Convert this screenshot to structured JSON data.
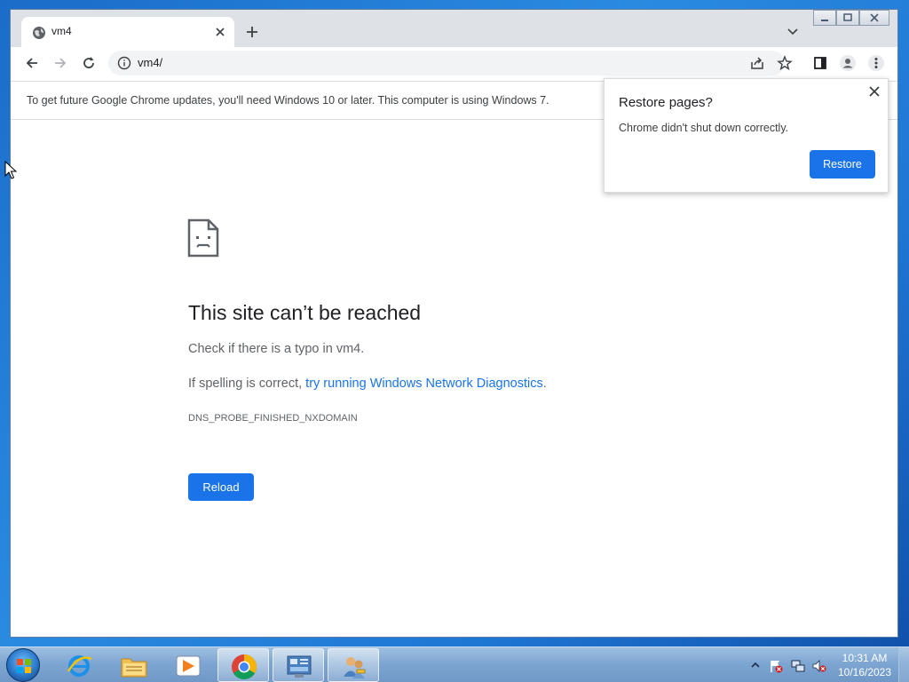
{
  "browser": {
    "tab_title": "vm4",
    "url": "vm4/",
    "infobar_text": "To get future Google Chrome updates, you'll need Windows 10 or later. This computer is using Windows 7."
  },
  "error_page": {
    "title": "This site can’t be reached",
    "line1": "Check if there is a typo in vm4.",
    "line2_prefix": "If spelling is correct, ",
    "line2_link": "try running Windows Network Diagnostics",
    "line2_suffix": ".",
    "error_code": "DNS_PROBE_FINISHED_NXDOMAIN",
    "reload_label": "Reload"
  },
  "restore_popup": {
    "title": "Restore pages?",
    "text": "Chrome didn't shut down correctly.",
    "button_label": "Restore"
  },
  "taskbar": {
    "items": [
      "internet-explorer",
      "windows-explorer",
      "media-player",
      "google-chrome",
      "control-panel",
      "user-accounts"
    ],
    "active_item": "google-chrome",
    "clock_time": "10:31 AM",
    "clock_date": "10/16/2023"
  },
  "colors": {
    "accent": "#1a73e8",
    "desktop": "#1f77d4"
  }
}
